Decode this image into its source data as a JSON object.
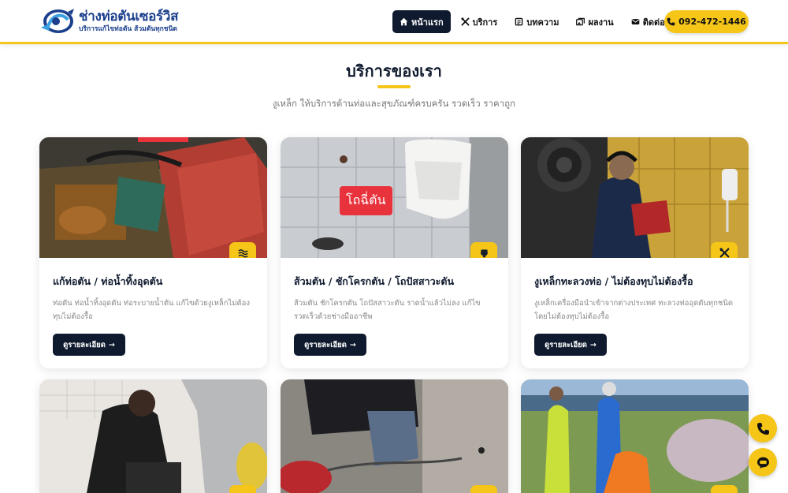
{
  "brand": {
    "title": "ช่างท่อตันเซอร์วิส",
    "subtitle": "บริการแก้ไขท่อตัน ส้วมตันทุกชนิด",
    "color": "#1b3f8c"
  },
  "nav": {
    "items": [
      {
        "label": "หน้าแรก",
        "icon": "home-icon",
        "active": true
      },
      {
        "label": "บริการ",
        "icon": "tools-icon"
      },
      {
        "label": "บทความ",
        "icon": "newspaper-icon"
      },
      {
        "label": "ผลงาน",
        "icon": "images-icon"
      },
      {
        "label": "ติดต่อเรา",
        "icon": "envelope-icon"
      }
    ],
    "phone": "092-472-1446"
  },
  "section": {
    "title": "บริการของเรา",
    "subtitle": "งูเหล็ก ให้บริการด้านท่อและสุขภัณฑ์ครบครัน รวดเร็ว ราคาถูก"
  },
  "cards": [
    {
      "title": "แก้ท่อตัน / ท่อน้ำทิ้งอุดตัน",
      "desc": "ท่อตัน ท่อน้ำทิ้งอุดตัน ท่อระบายน้ำตัน แก้ไขด้วยงูเหล็กไม่ต้องทุบไม่ต้องรื้อ",
      "button": "ดูรายละเอียด",
      "icon": "water-icon"
    },
    {
      "title": "ส้วมตัน / ชักโครกตัน / โถปัสสาวะตัน",
      "desc": "ส้วมตัน ชักโครกตัน โถปัสสาวะตัน ราดน้ำแล้วไม่ลง แก้ไขรวดเร็วด้วยช่างมืออาชีพ",
      "button": "ดูรายละเอียด",
      "icon": "toilet-icon",
      "tag": "โถฉี่ตัน"
    },
    {
      "title": "งูเหล็กทะลวงท่อ / ไม่ต้องทุบไม่ต้องรื้อ",
      "desc": "งูเหล็กเครื่องมือนำเข้าจากต่างประเทศ ทะลวงท่ออุดตันทุกชนิดโดยไม่ต้องทุบไม่ต้องรื้อ",
      "button": "ดูรายละเอียด",
      "icon": "tools-icon"
    }
  ],
  "colors": {
    "accent": "#f5c518",
    "dark": "#0f1a2e",
    "tag_red": "#e8323c"
  }
}
